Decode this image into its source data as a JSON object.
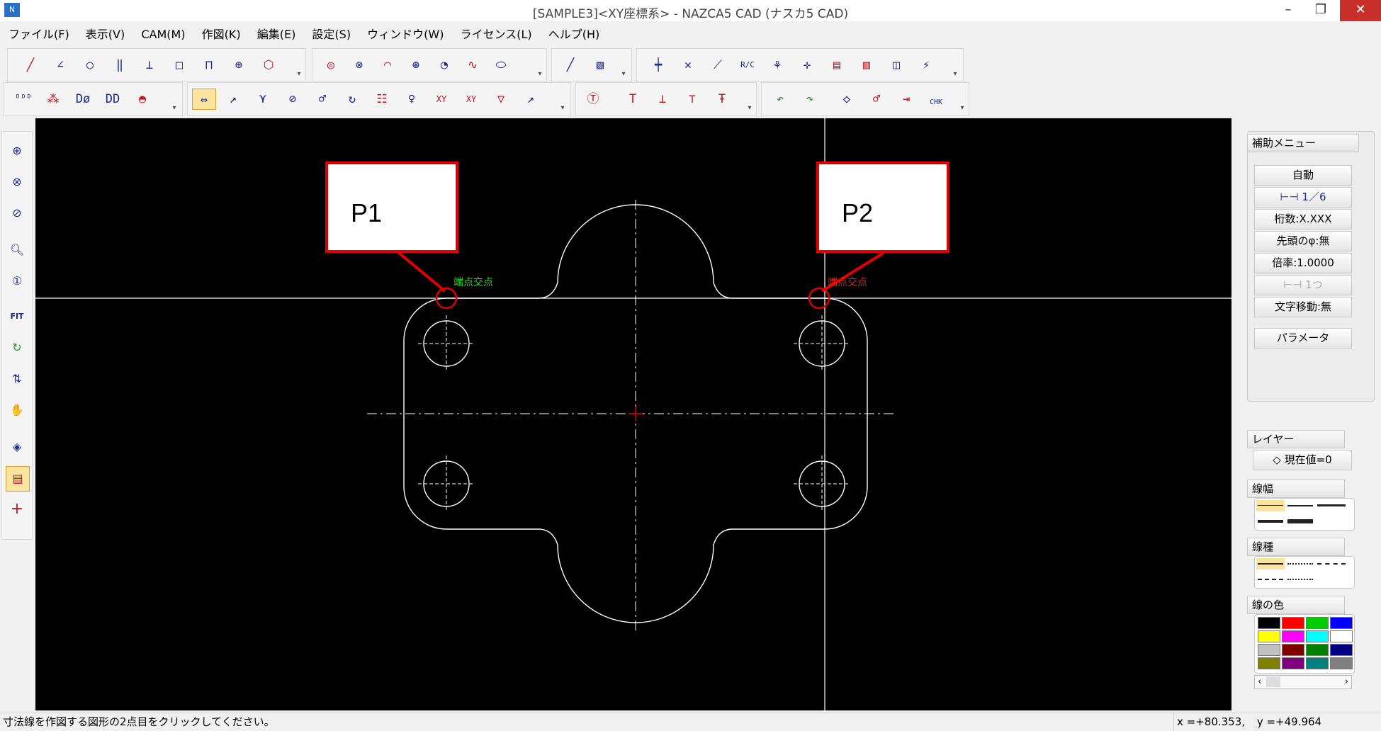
{
  "window": {
    "title": "[SAMPLE3]<XY座標系> - NAZCA5 CAD (ナスカ5 CAD)",
    "minimize": "–",
    "restore": "❐",
    "close": "✕"
  },
  "menu": [
    "ファイル(F)",
    "表示(V)",
    "CAM(M)",
    "作図(K)",
    "編集(E)",
    "設定(S)",
    "ウィンドウ(W)",
    "ライセンス(L)",
    "ヘルプ(H)"
  ],
  "toolbars": {
    "row1_icons": [
      "line-icon",
      "angle-line-icon",
      "circle-tangent-icon",
      "parallel-line-icon",
      "perpendicular-icon",
      "rectangle-icon",
      "polyline-icon",
      "crosshair-circle-icon",
      "hexagon-icon",
      "circle-icon",
      "circle-3p-icon",
      "arc-icon",
      "fillet-icon",
      "arc-tangent-icon",
      "curve-icon",
      "ellipse-icon",
      "construction-line-icon",
      "frame-icon",
      "trim-icon",
      "cross-delete-icon",
      "extend-icon",
      "rc-icon",
      "break-icon",
      "move-icon",
      "array-icon",
      "dim-array-icon",
      "layer-copy-icon",
      "snap-icon"
    ],
    "row2_icons": [
      "dim-d-icon",
      "dim-point-icon",
      "dim-diameter-icon",
      "dim-dd-icon",
      "protractor-icon",
      "dim-linear-icon",
      "dim-leader-icon",
      "dim-angle-icon",
      "dim-circle-icon",
      "dim-radius-icon",
      "dim-arc-icon",
      "dim-table-icon",
      "dim-origin-icon",
      "dim-xy-icon",
      "dim-xy2-icon",
      "dim-chain-icon",
      "dim-curve-icon",
      "text-icon",
      "text-frame-icon",
      "text-left-icon",
      "text-center-icon",
      "text-right-icon",
      "undo-icon",
      "redo-icon",
      "layer-icon",
      "link-icon",
      "mirror-icon",
      "check-icon"
    ]
  },
  "labels": {
    "xy": "XY",
    "rc": "R/C",
    "chk": "CHK",
    "fit": "FIT",
    "snap_text": "端点交点"
  },
  "canvas": {
    "callout_p1": "P1",
    "callout_p2": "P2"
  },
  "aux_menu": {
    "header": "補助メニュー",
    "buttons": [
      "自動",
      "1／6",
      "桁数:X.XXX",
      "先頭のφ:無",
      "倍率:1.0000",
      "1つ",
      "文字移動:無"
    ],
    "params": "パラメータ"
  },
  "layer": {
    "header": "レイヤー",
    "current": "現在値=0"
  },
  "line_width": {
    "header": "線幅"
  },
  "line_type": {
    "header": "線種"
  },
  "line_color": {
    "header": "線の色",
    "colors": [
      "#000000",
      "#ff0000",
      "#00cc00",
      "#0000ff",
      "#ffff00",
      "#ff00ff",
      "#00ffff",
      "#ffffff",
      "#c0c0c0",
      "#800000",
      "#008000",
      "#000080",
      "#808000",
      "#800080",
      "#008080",
      "#808080"
    ]
  },
  "status": {
    "message": "寸法線を作図する図形の2点目をクリックしてください。",
    "x": "x =+80.353,",
    "y": "y =+49.964"
  }
}
